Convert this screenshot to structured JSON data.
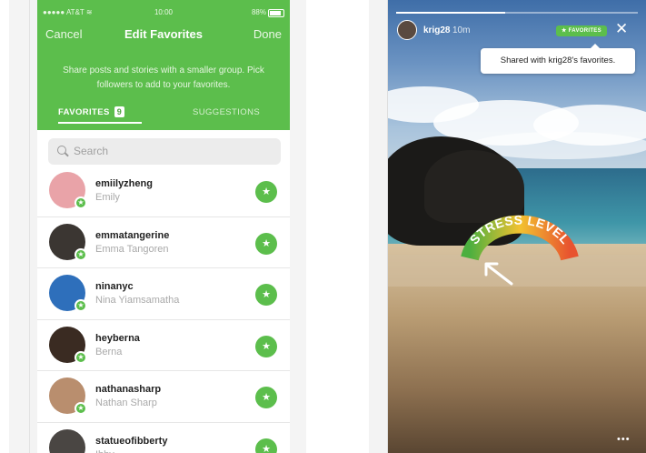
{
  "left_phone": {
    "status": {
      "carrier": "●●●●● AT&T ≋",
      "time": "10:00",
      "battery": "88%"
    },
    "nav": {
      "cancel": "Cancel",
      "title": "Edit Favorites",
      "done": "Done"
    },
    "description": "Share posts and stories with a smaller group. Pick followers to add to your favorites.",
    "tabs": {
      "favorites": "FAVORITES",
      "favorites_count": "9",
      "suggestions": "SUGGESTIONS"
    },
    "search_placeholder": "Search",
    "favorites": [
      {
        "username": "emiilyzheng",
        "name": "Emily",
        "avatar_color": "#e9a3a8"
      },
      {
        "username": "emmatangerine",
        "name": "Emma Tangoren",
        "avatar_color": "#3b3632"
      },
      {
        "username": "ninanyc",
        "name": "Nina Yiamsamatha",
        "avatar_color": "#2e6fbb"
      },
      {
        "username": "heyberna",
        "name": "Berna",
        "avatar_color": "#3a2b22"
      },
      {
        "username": "nathanasharp",
        "name": "Nathan Sharp",
        "avatar_color": "#b98e6e"
      },
      {
        "username": "statueofibberty",
        "name": "Ibby",
        "avatar_color": "#4a4643"
      }
    ],
    "accent": "#5cbe4c"
  },
  "right_phone": {
    "story": {
      "username": "krig28",
      "time": "10m",
      "audience_badge": "★ FAVORITES",
      "tooltip": "Shared with krig28's favorites.",
      "sticker_text": "STRESS LEVEL",
      "more": "•••",
      "progress": 0.45
    }
  }
}
